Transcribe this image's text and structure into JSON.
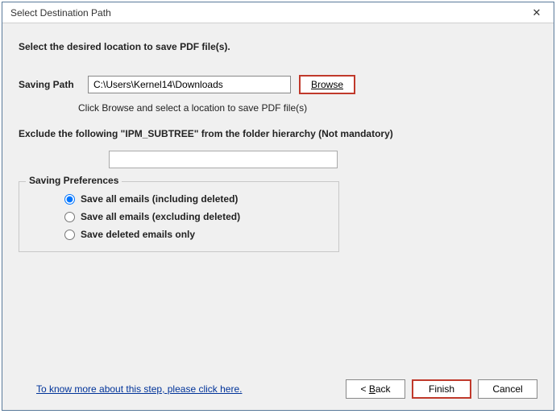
{
  "title": "Select Destination Path",
  "instruction": "Select the desired location to save PDF file(s).",
  "saving_path_label": "Saving Path",
  "saving_path_value": "C:\\Users\\Kernel14\\Downloads",
  "browse_label": "Browse",
  "browse_hint": "Click Browse and select a location to save PDF file(s)",
  "exclude_label": "Exclude the following \"IPM_SUBTREE\" from the folder hierarchy (Not mandatory)",
  "exclude_value": "",
  "group_title": "Saving Preferences",
  "options": {
    "opt1": "Save all emails (including deleted)",
    "opt2": "Save all emails (excluding deleted)",
    "opt3": "Save deleted emails only"
  },
  "selected_option": "opt1",
  "help_link": "To know more about this step, please click here.",
  "buttons": {
    "back_prefix": "< ",
    "back_u": "B",
    "back_rest": "ack",
    "finish": "Finish",
    "cancel": "Cancel"
  }
}
